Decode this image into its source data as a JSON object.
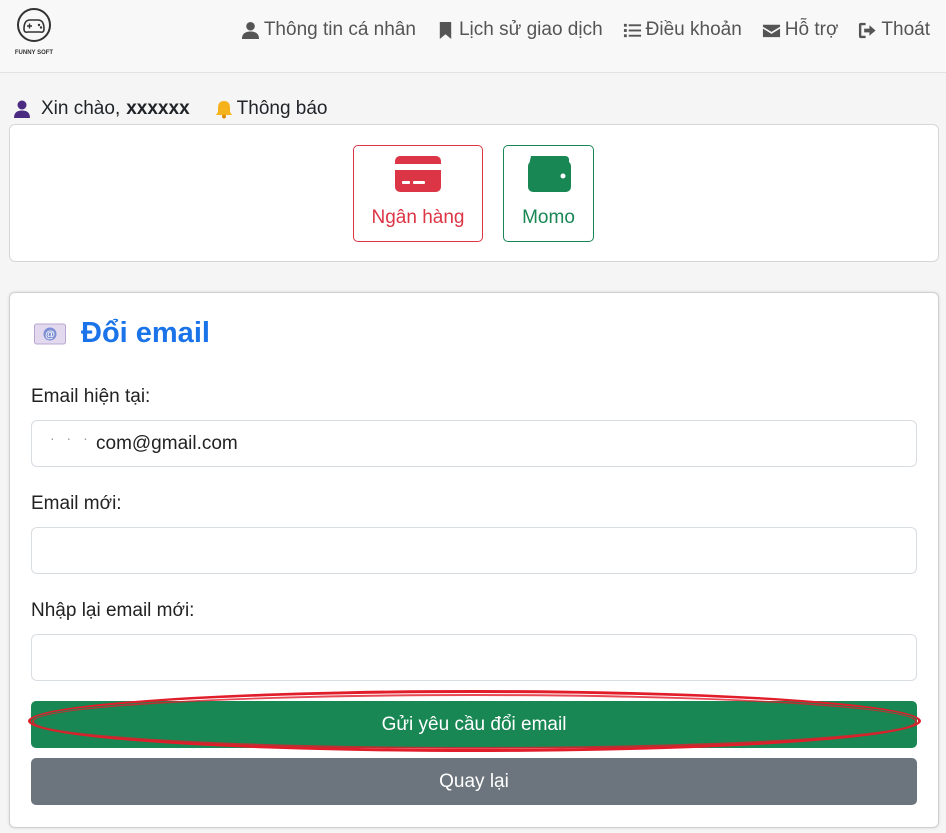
{
  "nav": {
    "logo_text": "FUNNY SOFT",
    "links": [
      {
        "label": "Thông tin cá nhân",
        "icon": "user-icon"
      },
      {
        "label": "Lịch sử giao dịch",
        "icon": "bookmark-icon"
      },
      {
        "label": "Điều khoản",
        "icon": "list-icon"
      },
      {
        "label": "Hỗ trợ",
        "icon": "envelope-icon"
      },
      {
        "label": "Thoát",
        "icon": "sign-out-icon"
      }
    ]
  },
  "greeting": {
    "prefix": "Xin chào,",
    "username": "xxxxxx",
    "notifications": "Thông báo"
  },
  "payment": {
    "bank_label": "Ngân hàng",
    "momo_label": "Momo"
  },
  "form": {
    "title": "Đổi email",
    "current_label": "Email hiện tại:",
    "current_value": "com@gmail.com",
    "new_label": "Email mới:",
    "new_value": "",
    "confirm_label": "Nhập lại email mới:",
    "confirm_value": "",
    "submit_label": "Gửi yêu cầu đổi email",
    "back_label": "Quay lại"
  },
  "colors": {
    "accent": "#1a73e8",
    "bank": "#dc3545",
    "momo": "#198754",
    "submit": "#198754",
    "back": "#6c757d",
    "highlight": "#e11d2a"
  }
}
